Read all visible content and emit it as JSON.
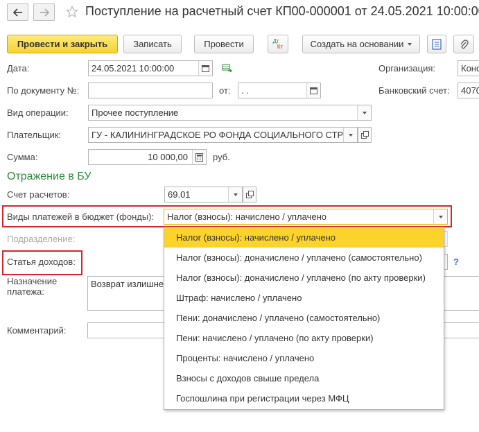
{
  "window": {
    "title": "Поступление на расчетный счет КП00-000001 от 24.05.2021 10:00:00"
  },
  "toolbar": {
    "post_close": "Провести и закрыть",
    "save": "Записать",
    "post": "Провести",
    "dt_kt_top": "Дт",
    "dt_kt_bottom": "Кт",
    "create_based": "Создать на основании"
  },
  "form": {
    "date_label": "Дата:",
    "date_value": "24.05.2021 10:00:00",
    "org_label": "Организация:",
    "org_value": "Конс",
    "doc_label": "По документу №:",
    "doc_value": "",
    "from_label": "от:",
    "from_value": " .  .",
    "bank_label": "Банковский счет:",
    "bank_value": "4070",
    "operation_label": "Вид операции:",
    "operation_value": "Прочее поступление",
    "payer_label": "Плательщик:",
    "payer_value": "ГУ - КАЛИНИНГРАДСКОЕ РО ФОНДА СОЦИАЛЬНОГО СТР",
    "sum_label": "Сумма:",
    "sum_value": "10 000,00",
    "currency": "руб."
  },
  "bu": {
    "section_title": "Отражение в БУ",
    "account_label": "Счет расчетов:",
    "account_value": "69.01",
    "payment_types_label": "Виды платежей в бюджет (фонды):",
    "payment_types_value": "Налог (взносы): начислено / уплачено",
    "subdivision_label": "Подразделение:",
    "income_label": "Статья доходов:",
    "help": "?",
    "purpose_label_1": "Назначение",
    "purpose_label_2": "платежа:",
    "purpose_value": "Возврат излишне",
    "comment_label": "Комментарий:"
  },
  "dropdown": {
    "options": [
      "Налог (взносы): начислено / уплачено",
      "Налог (взносы): доначислено / уплачено (самостоятельно)",
      "Налог (взносы): доначислено / уплачено (по акту проверки)",
      "Штраф: начислено / уплачено",
      "Пени: доначислено / уплачено (самостоятельно)",
      "Пени: начислено / уплачено (по акту проверки)",
      "Проценты: начислено / уплачено",
      "Взносы с доходов свыше предела",
      "Госпошлина при регистрации через МФЦ"
    ],
    "selected_index": 0
  },
  "colors": {
    "primary_button": "#f6d232",
    "section_green": "#2f8a3a",
    "highlight_red": "#d0272a",
    "selected_option": "#fcd32a"
  }
}
